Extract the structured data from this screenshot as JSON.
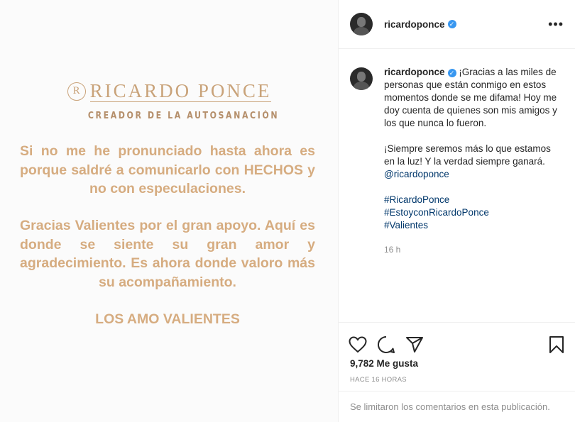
{
  "image": {
    "brand_mark": "R",
    "brand_name": "RICARDO PONCE",
    "brand_tagline": "CREADOR DE LA AUTOSANACIÓN",
    "paragraph_1": "Si no me he pronunciado hasta ahora es porque saldré a comunicarlo con HECHOS y no con especulaciones.",
    "paragraph_2": "Gracias Valientes por el gran apoyo. Aquí es donde se siente su gran amor y agradecimiento. Es ahora donde valoro más su acompañamiento.",
    "paragraph_3": "LOS AMO VALIENTES",
    "accent_color": "#d6ac80"
  },
  "header": {
    "username": "ricardoponce",
    "verified_icon": "verified-badge-icon",
    "more_icon": "more-options-icon",
    "more_label": "•••"
  },
  "caption": {
    "username": "ricardoponce",
    "text_1": "¡Gracias a las miles de personas que están conmigo en estos momentos donde se me difama! Hoy me doy cuenta de quienes son mis amigos y los que nunca lo fueron.",
    "text_2": "¡Siempre seremos más lo que estamos en la luz! Y la verdad siempre ganará.",
    "mention": "@ricardoponce",
    "hashtags": [
      "#RicardoPonce",
      "#EstoyconRicardoPonce",
      "#Valientes"
    ],
    "age": "16 h"
  },
  "actions": {
    "like_icon": "heart-icon",
    "comment_icon": "comment-icon",
    "share_icon": "share-icon",
    "save_icon": "bookmark-icon",
    "likes": "9,782 Me gusta",
    "timestamp": "HACE 16 HORAS",
    "comments_disabled": "Se limitaron los comentarios en esta publicación."
  },
  "colors": {
    "link": "#00376b",
    "verified": "#3897f0",
    "muted": "#8e8e8e"
  }
}
